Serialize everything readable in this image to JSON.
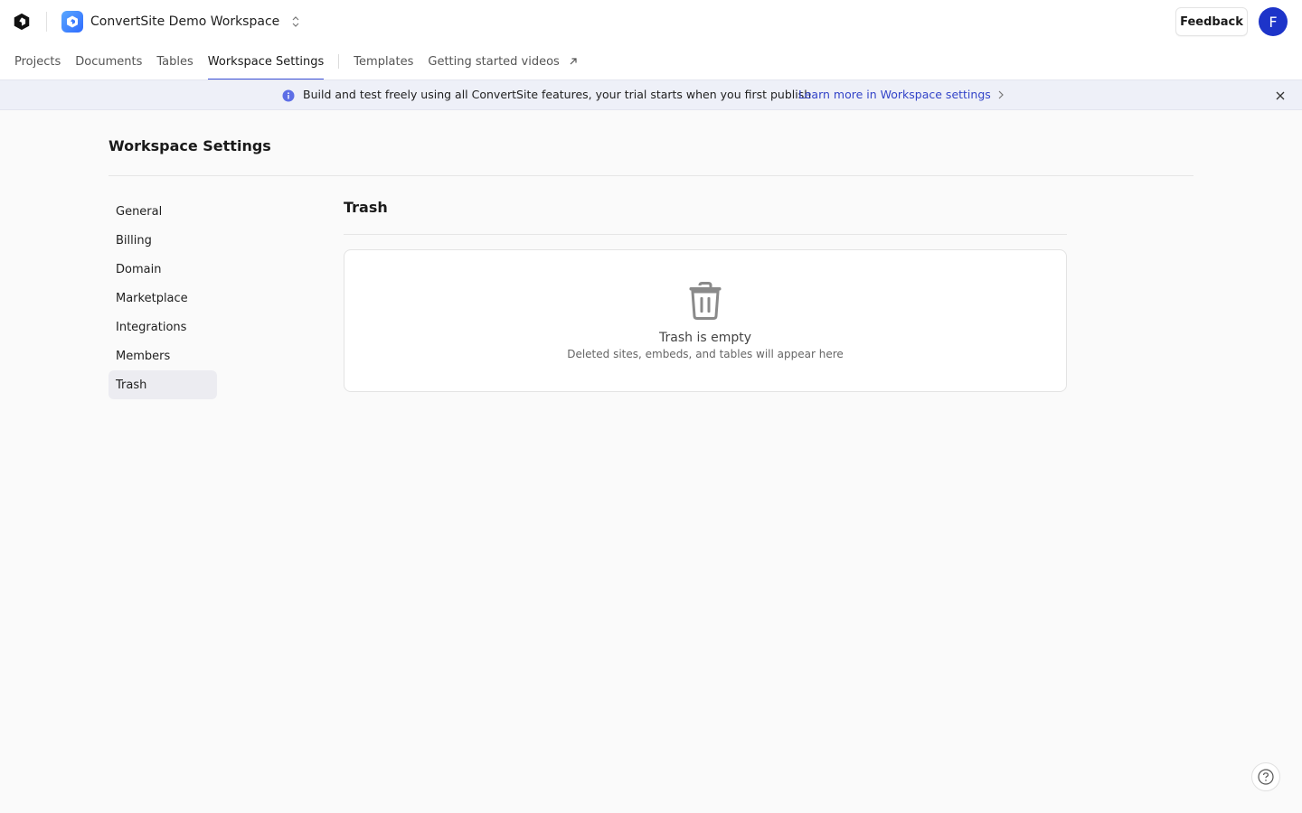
{
  "header": {
    "workspace_name": "ConvertSite Demo Workspace",
    "feedback_label": "Feedback",
    "avatar_initial": "F"
  },
  "nav": {
    "tabs": [
      {
        "label": "Projects"
      },
      {
        "label": "Documents"
      },
      {
        "label": "Tables"
      },
      {
        "label": "Workspace Settings",
        "active": true
      }
    ],
    "secondary": [
      {
        "label": "Templates"
      },
      {
        "label": "Getting started videos"
      }
    ]
  },
  "banner": {
    "text": "Build and test freely using all ConvertSite features, your trial starts when you first publish",
    "link": "Learn more in Workspace settings"
  },
  "page": {
    "title": "Workspace Settings"
  },
  "sidebar": {
    "items": [
      {
        "label": "General"
      },
      {
        "label": "Billing"
      },
      {
        "label": "Domain"
      },
      {
        "label": "Marketplace"
      },
      {
        "label": "Integrations"
      },
      {
        "label": "Members"
      },
      {
        "label": "Trash",
        "active": true
      }
    ]
  },
  "trash": {
    "title": "Trash",
    "empty_title": "Trash is empty",
    "empty_subtitle": "Deleted sites, embeds, and tables will appear here"
  },
  "colors": {
    "accent": "#3b4fd8",
    "link": "#3344c8",
    "avatar": "#1d34c9",
    "banner_bg": "#eef0f8"
  }
}
